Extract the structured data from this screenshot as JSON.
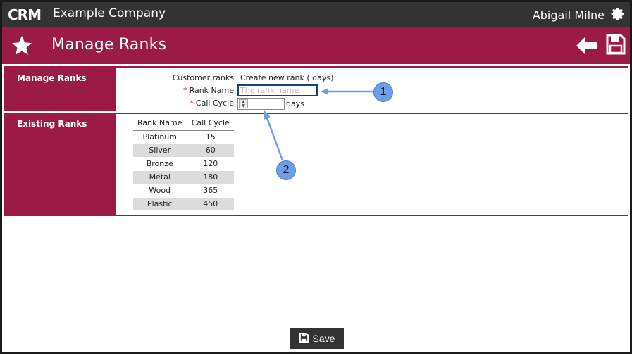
{
  "app": {
    "logo_text": "CRM",
    "company": "Example Company",
    "user": "Abigail Milne"
  },
  "header": {
    "title": "Manage Ranks"
  },
  "manage_section": {
    "label": "Manage Ranks",
    "customer_ranks_label": "Customer ranks",
    "create_text": "Create new rank ( days)",
    "rank_name_label": "Rank Name",
    "rank_name_placeholder": "The rank name",
    "call_cycle_label": "Call Cycle",
    "call_cycle_value": "",
    "days_unit": "days",
    "required_marker": "*"
  },
  "existing_section": {
    "label": "Existing Ranks",
    "columns": [
      "Rank Name",
      "Call Cycle"
    ],
    "rows": [
      {
        "name": "Platinum",
        "cycle": "15"
      },
      {
        "name": "Silver",
        "cycle": "60"
      },
      {
        "name": "Bronze",
        "cycle": "120"
      },
      {
        "name": "Metal",
        "cycle": "180"
      },
      {
        "name": "Wood",
        "cycle": "365"
      },
      {
        "name": "Plastic",
        "cycle": "450"
      }
    ]
  },
  "callouts": [
    "1",
    "2"
  ],
  "footer": {
    "save_label": "Save"
  },
  "colors": {
    "brand": "#9b1b46",
    "topbar": "#333333",
    "callout": "#6f9ee8"
  },
  "icons": [
    "crm-logo-icon",
    "gear-icon",
    "star-icon",
    "back-arrow-icon",
    "save-icon",
    "floppy-icon"
  ]
}
